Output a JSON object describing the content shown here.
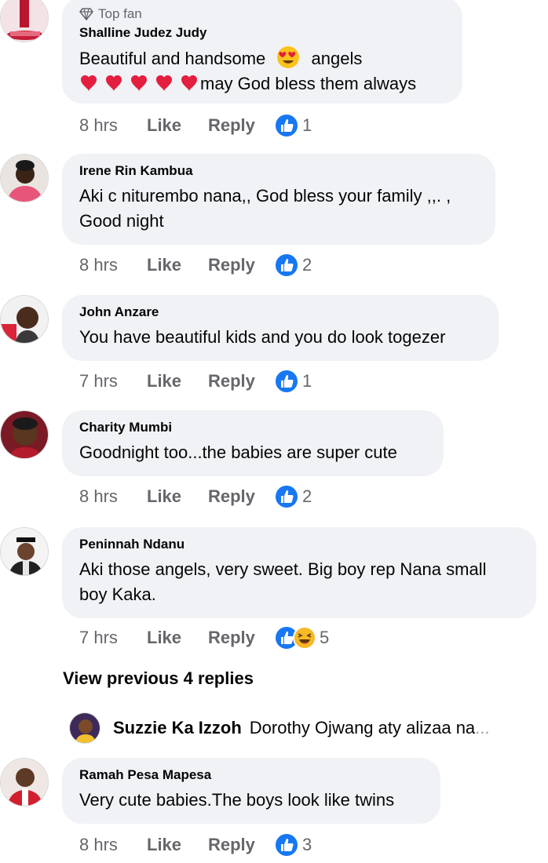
{
  "comments": [
    {
      "badge": "Top fan",
      "author": "Shalline Judez Judy",
      "line1_a": "Beautiful  and handsome",
      "line1_b": "angels",
      "line2": "may God  bless them always",
      "time": "8 hrs",
      "like": "Like",
      "reply": "Reply",
      "reactions": "1"
    },
    {
      "author": "Irene Rin Kambua",
      "line1": "Aki c niturembo nana,, God bless your family ,,. ,",
      "line2": "Good night",
      "time": "8 hrs",
      "like": "Like",
      "reply": "Reply",
      "reactions": "2"
    },
    {
      "author": "John Anzare",
      "line1": "You have beautiful kids and you do look togezer",
      "time": "7 hrs",
      "like": "Like",
      "reply": "Reply",
      "reactions": "1"
    },
    {
      "author": "Charity Mumbi",
      "line1": "Goodnight too...the babies are super cute",
      "time": "8 hrs",
      "like": "Like",
      "reply": "Reply",
      "reactions": "2"
    },
    {
      "author": "Peninnah Ndanu",
      "line1": "Aki those angels, very sweet. Big boy rep Nana small",
      "line2": "boy Kaka.",
      "time": "7 hrs",
      "like": "Like",
      "reply": "Reply",
      "reactions": "5"
    },
    {
      "author": "Ramah Pesa Mapesa",
      "line1": "Very cute babies.The boys look like twins",
      "time": "8 hrs",
      "like": "Like",
      "reply": "Reply",
      "reactions": "3"
    }
  ],
  "view_previous": "View previous 4 replies",
  "reply_preview": {
    "author": "Suzzie Ka Izzoh",
    "snippet": "Dorothy Ojwang aty alizaa na",
    "ellipsis": "..."
  },
  "colors": {
    "like_blue": "#1877f2",
    "bubble": "#f0f2f5",
    "meta": "#65676b",
    "heart": "#e41e3f"
  },
  "icons": [
    "diamond-icon",
    "heart-icon",
    "heart-eyes-emoji",
    "like-icon",
    "haha-icon"
  ]
}
